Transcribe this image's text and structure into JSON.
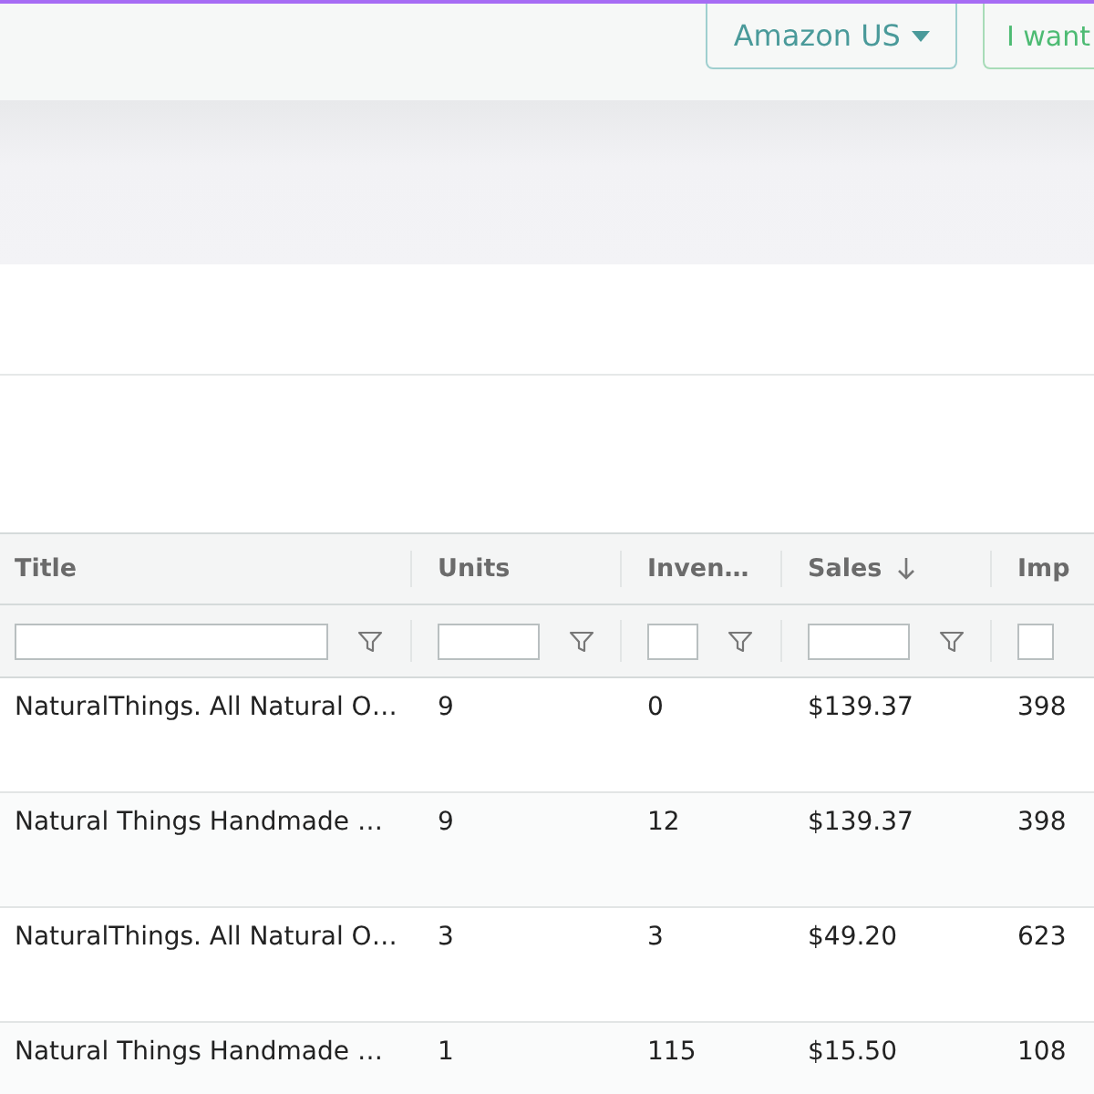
{
  "header": {
    "buttons": [
      {
        "label": "Amazon US",
        "kind": "dropdown"
      },
      {
        "label": "I want",
        "kind": "plain"
      }
    ]
  },
  "table": {
    "columns": [
      {
        "label": "Title",
        "sorted": false
      },
      {
        "label": "Units",
        "sorted": false
      },
      {
        "label": "Inven…",
        "sorted": false
      },
      {
        "label": "Sales",
        "sorted": true
      },
      {
        "label": "Imp",
        "sorted": false
      }
    ],
    "rows": [
      [
        "NaturalThings. All Natural O…",
        "9",
        "0",
        "$139.37",
        "398"
      ],
      [
        "Natural Things Handmade …",
        "9",
        "12",
        "$139.37",
        "398"
      ],
      [
        "NaturalThings. All Natural O…",
        "3",
        "3",
        "$49.20",
        "623"
      ],
      [
        "Natural Things Handmade …",
        "1",
        "115",
        "$15.50",
        "108"
      ]
    ]
  }
}
